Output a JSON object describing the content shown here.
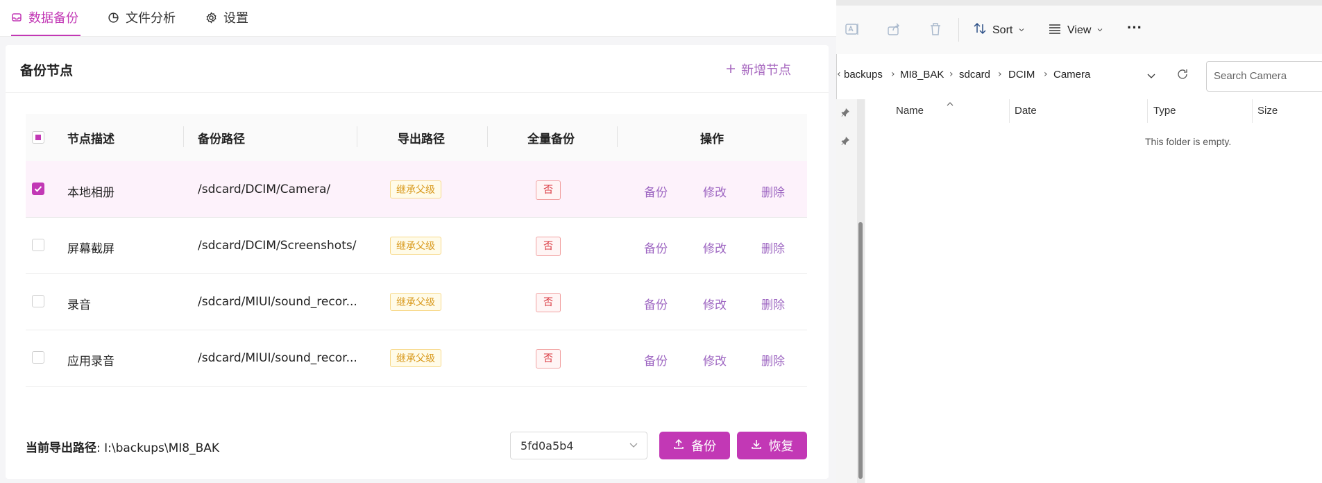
{
  "nav": {
    "tabs": [
      {
        "label": "数据备份",
        "icon": "inbox-icon",
        "active": true
      },
      {
        "label": "文件分析",
        "icon": "pie-chart-icon",
        "active": false
      },
      {
        "label": "设置",
        "icon": "gear-icon",
        "active": false
      }
    ]
  },
  "panel": {
    "title": "备份节点",
    "add_label": "新增节点"
  },
  "table": {
    "columns": [
      "节点描述",
      "备份路径",
      "导出路径",
      "全量备份",
      "操作"
    ],
    "rows": [
      {
        "checked": true,
        "desc": "本地相册",
        "path": "/sdcard/DCIM/Camera/",
        "export": "继承父级",
        "full": "否",
        "actions": [
          "备份",
          "修改",
          "删除"
        ]
      },
      {
        "checked": false,
        "desc": "屏幕截屏",
        "path": "/sdcard/DCIM/Screenshots/",
        "export": "继承父级",
        "full": "否",
        "actions": [
          "备份",
          "修改",
          "删除"
        ]
      },
      {
        "checked": false,
        "desc": "录音",
        "path": "/sdcard/MIUI/sound_recor...",
        "export": "继承父级",
        "full": "否",
        "actions": [
          "备份",
          "修改",
          "删除"
        ]
      },
      {
        "checked": false,
        "desc": "应用录音",
        "path": "/sdcard/MIUI/sound_recor...",
        "export": "继承父级",
        "full": "否",
        "actions": [
          "备份",
          "修改",
          "删除"
        ]
      }
    ]
  },
  "footer": {
    "path_label": "当前导出路径",
    "path_value": ": I:\\backups\\MI8_BAK",
    "device": "5fd0a5b4",
    "backup_label": "备份",
    "restore_label": "恢复"
  },
  "explorer": {
    "toolbar": {
      "sort_label": "Sort",
      "view_label": "View",
      "more_label": "···"
    },
    "breadcrumb": [
      "backups",
      "MI8_BAK",
      "sdcard",
      "DCIM",
      "Camera"
    ],
    "search_placeholder": "Search Camera",
    "columns": [
      "Name",
      "Date",
      "Type",
      "Size"
    ],
    "empty_message": "This folder is empty."
  },
  "colors": {
    "accent": "#c238b5",
    "link": "#9e67c2",
    "warning_tag": "#d99a1e",
    "danger_tag": "#d9363e"
  }
}
